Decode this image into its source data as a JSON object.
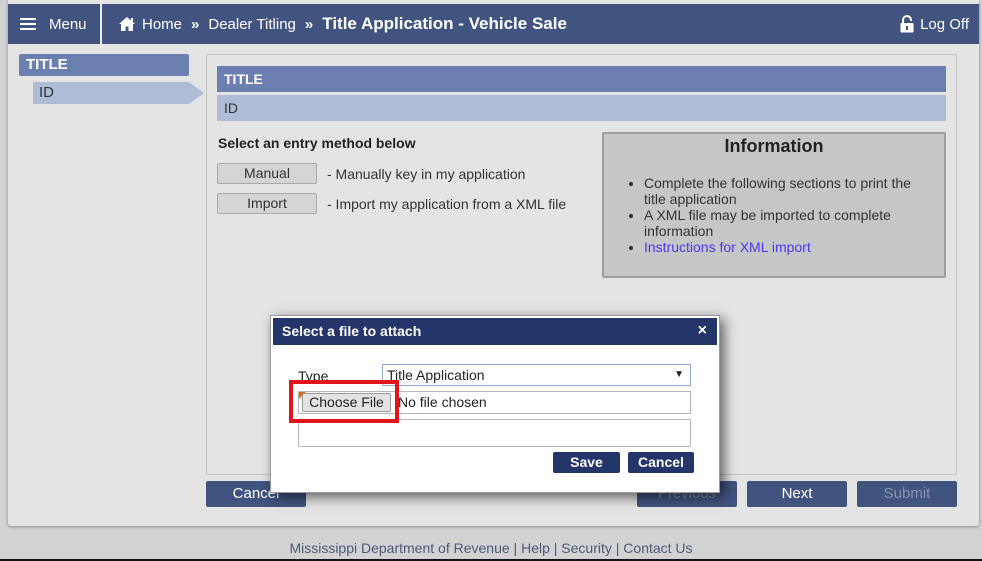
{
  "header": {
    "menu_label": "Menu",
    "breadcrumb": {
      "home": "Home",
      "separator": "»",
      "section": "Dealer Titling",
      "current": "Title Application - Vehicle Sale"
    },
    "logoff_label": "Log Off"
  },
  "sidebar": {
    "group": "TITLE",
    "items": [
      {
        "label": "ID",
        "active": true
      }
    ]
  },
  "main": {
    "section_title": "TITLE",
    "subsection_title": "ID",
    "entry_heading": "Select an entry method below",
    "entry_options": [
      {
        "button": "Manual",
        "description": "- Manually key in my application"
      },
      {
        "button": "Import",
        "description": "- Import my application from a XML file"
      }
    ],
    "info": {
      "title": "Information",
      "items": [
        "Complete the following sections to print the title application",
        "A XML file may be imported to complete information"
      ],
      "link": "Instructions for XML import"
    },
    "buttons": {
      "cancel": "Cancel",
      "previous": "Previous",
      "next": "Next",
      "submit": "Submit"
    }
  },
  "dialog": {
    "title": "Select a file to attach",
    "close": "×",
    "type_label": "Type",
    "type_value": "Title Application",
    "choose_file": "Choose File",
    "no_file": "No file chosen",
    "description_value": "",
    "save": "Save",
    "cancel": "Cancel"
  },
  "footer": {
    "org": "Mississippi Department of Revenue",
    "links": [
      "Help",
      "Security",
      "Contact Us"
    ],
    "separator": "|"
  },
  "colors": {
    "header_bg": "#415480",
    "nav_title_bg": "#6b7fb0",
    "nav_item_bg": "#aebcd6",
    "dialog_header_bg": "#243569",
    "highlight": "#e0141b",
    "link": "#4b3ae8"
  }
}
